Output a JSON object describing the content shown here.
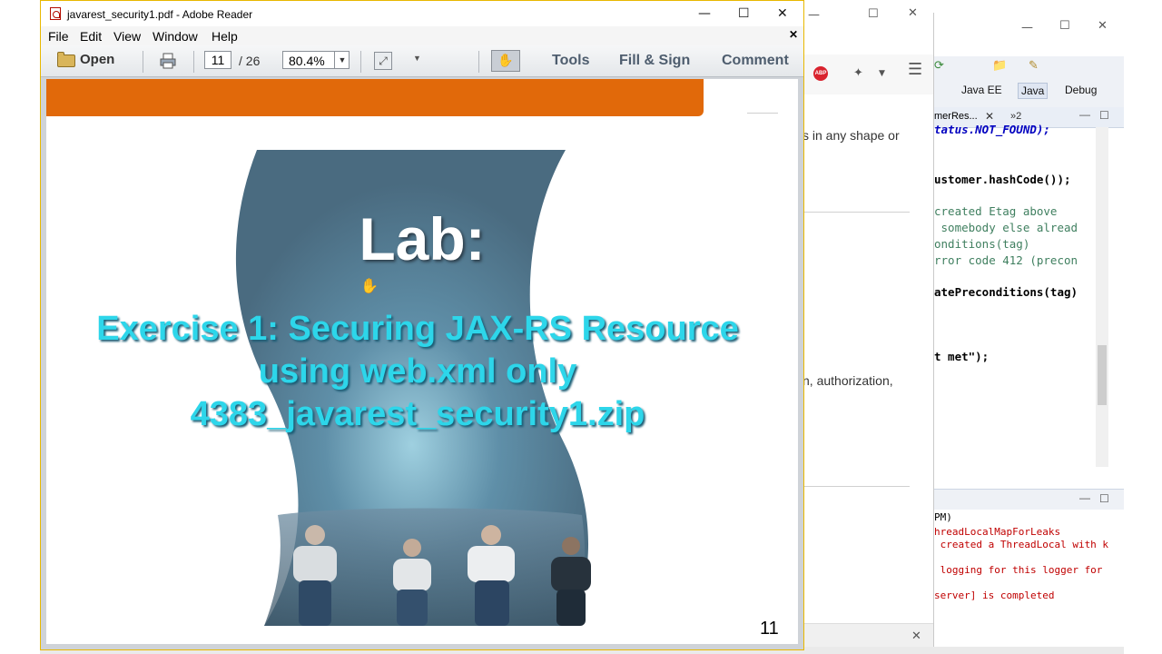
{
  "reader": {
    "title": "javarest_security1.pdf - Adobe Reader",
    "menu": [
      "File",
      "Edit",
      "View",
      "Window",
      "Help"
    ],
    "toolbar": {
      "open_label": "Open",
      "page_current": "11",
      "page_total": "/ 26",
      "zoom": "80.4%",
      "tools_label": "Tools",
      "fill_sign_label": "Fill & Sign",
      "comment_label": "Comment"
    },
    "page": {
      "title": "Lab:",
      "exercise_lines": [
        "Exercise 1: Securing JAX-RS Resource",
        "using web.xml only",
        "4383_javarest_security1.zip"
      ],
      "page_number": "11"
    },
    "colors": {
      "orange_band": "#e1690a",
      "wave_blue": "#4f7389",
      "exercise_text": "#2dd6ea"
    }
  },
  "browser": {
    "adblock_label": "ABP",
    "text_1": "s in any shape or",
    "text_2": "n, authorization,"
  },
  "eclipse": {
    "perspectives": [
      "Java EE",
      "Java",
      "Debug"
    ],
    "editor_tab": "merRes...",
    "editor_tab_extra": "»2",
    "code_lines": [
      "tatus.NOT_FOUND);",
      "ustomer.hashCode());",
      "created Etag above",
      " somebody else alread",
      "onditions(tag)",
      "rror code 412 (precon",
      "atePreconditions(tag)",
      "t met\");"
    ],
    "console_lines": [
      "PM)",
      "hreadLocalMapForLeaks",
      " created a ThreadLocal with k",
      " logging for this logger for",
      "server] is completed"
    ]
  }
}
